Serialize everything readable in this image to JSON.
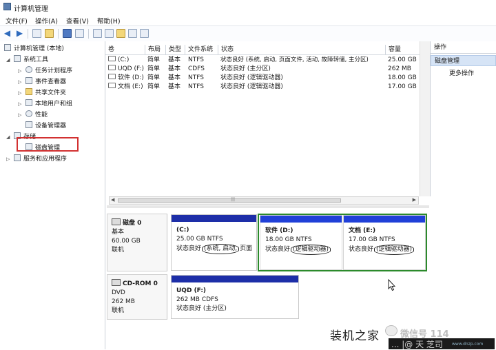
{
  "window": {
    "title": "计算机管理"
  },
  "menu": [
    {
      "label": "文件(F)"
    },
    {
      "label": "操作(A)"
    },
    {
      "label": "查看(V)"
    },
    {
      "label": "帮助(H)"
    }
  ],
  "tree": {
    "root": "计算机管理 (本地)",
    "items": [
      {
        "label": "系统工具"
      },
      {
        "label": "任务计划程序"
      },
      {
        "label": "事件查看器"
      },
      {
        "label": "共享文件夹"
      },
      {
        "label": "本地用户和组"
      },
      {
        "label": "性能"
      },
      {
        "label": "设备管理器"
      },
      {
        "label": "存储"
      },
      {
        "label": "磁盘管理"
      },
      {
        "label": "服务和应用程序"
      }
    ]
  },
  "volumes": {
    "headers": [
      "卷",
      "布局",
      "类型",
      "文件系统",
      "状态",
      "容量"
    ],
    "rows": [
      {
        "vol": "(C:)",
        "layout": "简单",
        "type": "基本",
        "fs": "NTFS",
        "status": "状态良好 (系统, 启动, 页面文件, 活动, 故障转储, 主分区)",
        "cap": "25.00 GB"
      },
      {
        "vol": "UQD (F:)",
        "layout": "简单",
        "type": "基本",
        "fs": "CDFS",
        "status": "状态良好 (主分区)",
        "cap": "262 MB"
      },
      {
        "vol": "软件 (D:)",
        "layout": "简单",
        "type": "基本",
        "fs": "NTFS",
        "status": "状态良好 (逻辑驱动器)",
        "cap": "18.00 GB"
      },
      {
        "vol": "文档 (E:)",
        "layout": "简单",
        "type": "基本",
        "fs": "NTFS",
        "status": "状态良好 (逻辑驱动器)",
        "cap": "17.00 GB"
      }
    ]
  },
  "disks": [
    {
      "name": "磁盘 0",
      "type": "基本",
      "size": "60.00 GB",
      "state": "联机",
      "partitions": [
        {
          "title": "(C:)",
          "detail": "25.00 GB NTFS",
          "status_prefix": "状态良好",
          "status_marked": "(系统, 启动,",
          "status_rest": "页面"
        },
        {
          "title": "软件 (D:)",
          "detail": "18.00 GB NTFS",
          "status_prefix": "状态良好",
          "status_marked": "(逻辑驱动器)",
          "status_rest": ""
        },
        {
          "title": "文档 (E:)",
          "detail": "17.00 GB NTFS",
          "status_prefix": "状态良好",
          "status_marked": "(逻辑驱动器)",
          "status_rest": ""
        }
      ]
    },
    {
      "name": "CD-ROM 0",
      "type": "DVD",
      "size": "262 MB",
      "state": "联机",
      "partitions": [
        {
          "title": "UQD (F:)",
          "detail": "262 MB CDFS",
          "status_prefix": "状态良好 (主分区)"
        }
      ]
    }
  ],
  "actions": {
    "header": "操作",
    "selected": "磁盘管理",
    "more": "更多操作"
  },
  "watermark": {
    "site": "装机之家",
    "wechat": "微信号 114",
    "handle": "...   |@  天  芝司",
    "small": "www.dnzp.com"
  }
}
